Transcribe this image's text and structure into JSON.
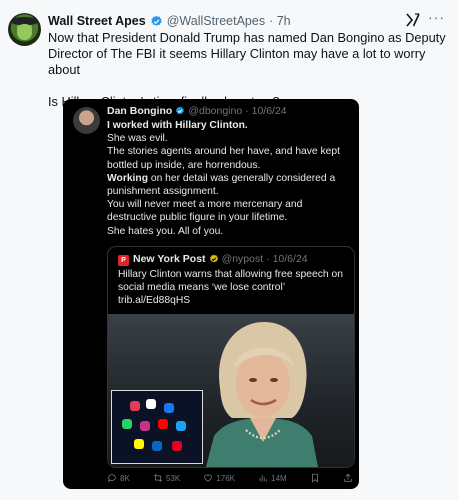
{
  "post": {
    "display_name": "Wall Street Apes",
    "handle": "@WallStreetApes",
    "time": "· 7h",
    "more_label": "···",
    "text_line1": "Now that President Donald Trump has named Dan Bongino as Deputy Director of The FBI it seems Hillary Clinton may have a lot to worry about",
    "text_line2": "Is Hillary Clinton’s time finally almost up?"
  },
  "embedded": {
    "display_name": "Dan Bongino",
    "handle": "@dbongino",
    "time": "· 10/6/24",
    "lines": {
      "l1": "I worked with Hillary Clinton.",
      "l2": "She was evil.",
      "l3": "The stories agents around her have, and have kept bottled up inside, are horrendous.",
      "l4_bold": "Working",
      "l4_rest": " on her detail was generally considered a punishment assignment.",
      "l5": "You will never meet a more mercenary and destructive public figure in your lifetime.",
      "l6": "She hates you. All of you."
    },
    "quote": {
      "logo_text": "P",
      "display_name": "New York Post",
      "handle": "@nypost",
      "time": "· 10/6/24",
      "text": "Hillary Clinton warns that allowing free speech on social media means ‘we lose control’ trib.al/Ed88qHS"
    },
    "stats": {
      "replies": "8K",
      "reposts": "53K",
      "likes": "176K",
      "views": "14M"
    }
  },
  "colors": {
    "verified_blue": "#1d9bf0",
    "verified_gold": "#e2b719",
    "nypost_red": "#e0242c"
  },
  "icons": [
    "verified-badge-icon",
    "x-grok-icon",
    "more-icon",
    "reply-icon",
    "repost-icon",
    "like-icon",
    "views-icon",
    "bookmark-icon",
    "share-icon"
  ]
}
